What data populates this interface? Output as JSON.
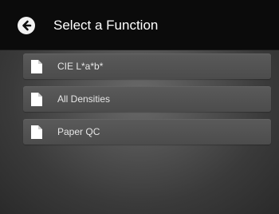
{
  "header": {
    "title": "Select a Function",
    "back_icon": "arrow-left-circle-icon"
  },
  "menu": {
    "items": [
      {
        "label": "CIE L*a*b*",
        "icon": "document-icon"
      },
      {
        "label": "All Densities",
        "icon": "document-icon"
      },
      {
        "label": "Paper QC",
        "icon": "document-icon"
      }
    ]
  },
  "colors": {
    "header_bg": "#0b0b0b",
    "item_bg": "#525252",
    "text": "#e6e6e6"
  }
}
